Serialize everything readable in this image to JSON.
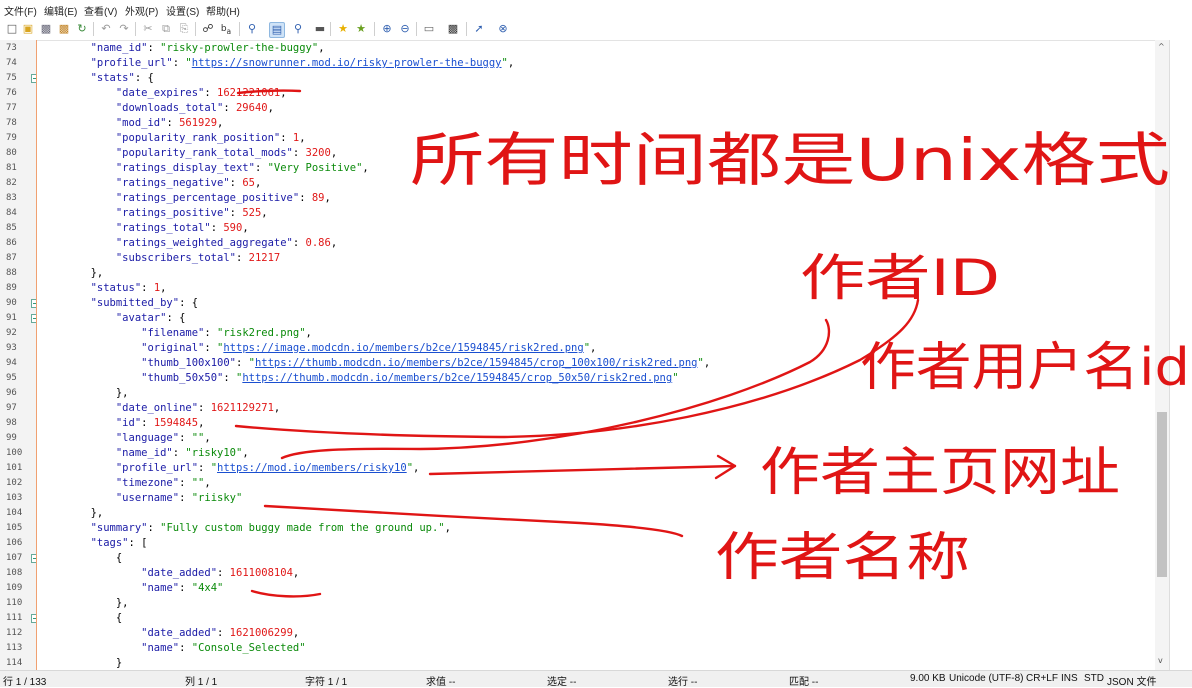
{
  "menu": [
    "文件(F)",
    "编辑(E)",
    "查看(V)",
    "外观(P)",
    "设置(S)",
    "帮助(H)"
  ],
  "toolbar_icons": [
    "new-file-icon",
    "open-file-icon",
    "save-icon",
    "save-all-icon",
    "reload-icon",
    "undo-icon",
    "redo-icon",
    "cut-icon",
    "copy-icon",
    "paste-icon",
    "find-icon",
    "replace-icon",
    "find-in-files-icon",
    "wrap-toggle-icon",
    "zoom-icon",
    "bookmark-icon",
    "bookmark-next-icon",
    "zoom-in-icon",
    "zoom-out-icon",
    "view-icon",
    "terminal-icon",
    "pin-icon",
    "close-icon"
  ],
  "code": {
    "line_numbers": [
      "73",
      "74",
      "75",
      "76",
      "77",
      "78",
      "79",
      "80",
      "81",
      "82",
      "83",
      "84",
      "85",
      "86",
      "87",
      "88",
      "89",
      "90",
      "91",
      "92",
      "93",
      "94",
      "95",
      "96",
      "97",
      "98",
      "99",
      "100",
      "101",
      "102",
      "103",
      "104",
      "105",
      "106",
      "107",
      "108",
      "109",
      "110",
      "111",
      "112",
      "113",
      "114"
    ],
    "folds": [
      "75",
      "90",
      "91",
      "107",
      "111"
    ],
    "lines": [
      {
        "indent": "        ",
        "parts": [
          {
            "c": "k",
            "t": "\"name_id\""
          },
          {
            "c": "p",
            "t": ": "
          },
          {
            "c": "s",
            "t": "\"risky-prowler-the-buggy\""
          },
          {
            "c": "p",
            "t": ","
          }
        ]
      },
      {
        "indent": "        ",
        "parts": [
          {
            "c": "k",
            "t": "\"profile_url\""
          },
          {
            "c": "p",
            "t": ": "
          },
          {
            "c": "q",
            "t": "\""
          },
          {
            "c": "u",
            "t": "https://snowrunner.mod.io/risky-prowler-the-buggy"
          },
          {
            "c": "q",
            "t": "\""
          },
          {
            "c": "p",
            "t": ","
          }
        ]
      },
      {
        "indent": "        ",
        "parts": [
          {
            "c": "k",
            "t": "\"stats\""
          },
          {
            "c": "p",
            "t": ": {"
          }
        ]
      },
      {
        "indent": "            ",
        "parts": [
          {
            "c": "k",
            "t": "\"date_expires\""
          },
          {
            "c": "p",
            "t": ": "
          },
          {
            "c": "n",
            "t": "1621221061"
          },
          {
            "c": "p",
            "t": ","
          }
        ]
      },
      {
        "indent": "            ",
        "parts": [
          {
            "c": "k",
            "t": "\"downloads_total\""
          },
          {
            "c": "p",
            "t": ": "
          },
          {
            "c": "n",
            "t": "29640"
          },
          {
            "c": "p",
            "t": ","
          }
        ]
      },
      {
        "indent": "            ",
        "parts": [
          {
            "c": "k",
            "t": "\"mod_id\""
          },
          {
            "c": "p",
            "t": ": "
          },
          {
            "c": "n",
            "t": "561929"
          },
          {
            "c": "p",
            "t": ","
          }
        ]
      },
      {
        "indent": "            ",
        "parts": [
          {
            "c": "k",
            "t": "\"popularity_rank_position\""
          },
          {
            "c": "p",
            "t": ": "
          },
          {
            "c": "n",
            "t": "1"
          },
          {
            "c": "p",
            "t": ","
          }
        ]
      },
      {
        "indent": "            ",
        "parts": [
          {
            "c": "k",
            "t": "\"popularity_rank_total_mods\""
          },
          {
            "c": "p",
            "t": ": "
          },
          {
            "c": "n",
            "t": "3200"
          },
          {
            "c": "p",
            "t": ","
          }
        ]
      },
      {
        "indent": "            ",
        "parts": [
          {
            "c": "k",
            "t": "\"ratings_display_text\""
          },
          {
            "c": "p",
            "t": ": "
          },
          {
            "c": "s",
            "t": "\"Very Positive\""
          },
          {
            "c": "p",
            "t": ","
          }
        ]
      },
      {
        "indent": "            ",
        "parts": [
          {
            "c": "k",
            "t": "\"ratings_negative\""
          },
          {
            "c": "p",
            "t": ": "
          },
          {
            "c": "n",
            "t": "65"
          },
          {
            "c": "p",
            "t": ","
          }
        ]
      },
      {
        "indent": "            ",
        "parts": [
          {
            "c": "k",
            "t": "\"ratings_percentage_positive\""
          },
          {
            "c": "p",
            "t": ": "
          },
          {
            "c": "n",
            "t": "89"
          },
          {
            "c": "p",
            "t": ","
          }
        ]
      },
      {
        "indent": "            ",
        "parts": [
          {
            "c": "k",
            "t": "\"ratings_positive\""
          },
          {
            "c": "p",
            "t": ": "
          },
          {
            "c": "n",
            "t": "525"
          },
          {
            "c": "p",
            "t": ","
          }
        ]
      },
      {
        "indent": "            ",
        "parts": [
          {
            "c": "k",
            "t": "\"ratings_total\""
          },
          {
            "c": "p",
            "t": ": "
          },
          {
            "c": "n",
            "t": "590"
          },
          {
            "c": "p",
            "t": ","
          }
        ]
      },
      {
        "indent": "            ",
        "parts": [
          {
            "c": "k",
            "t": "\"ratings_weighted_aggregate\""
          },
          {
            "c": "p",
            "t": ": "
          },
          {
            "c": "n",
            "t": "0.86"
          },
          {
            "c": "p",
            "t": ","
          }
        ]
      },
      {
        "indent": "            ",
        "parts": [
          {
            "c": "k",
            "t": "\"subscribers_total\""
          },
          {
            "c": "p",
            "t": ": "
          },
          {
            "c": "n",
            "t": "21217"
          }
        ]
      },
      {
        "indent": "        ",
        "parts": [
          {
            "c": "p",
            "t": "},"
          }
        ]
      },
      {
        "indent": "        ",
        "parts": [
          {
            "c": "k",
            "t": "\"status\""
          },
          {
            "c": "p",
            "t": ": "
          },
          {
            "c": "n",
            "t": "1"
          },
          {
            "c": "p",
            "t": ","
          }
        ]
      },
      {
        "indent": "        ",
        "parts": [
          {
            "c": "k",
            "t": "\"submitted_by\""
          },
          {
            "c": "p",
            "t": ": {"
          }
        ]
      },
      {
        "indent": "            ",
        "parts": [
          {
            "c": "k",
            "t": "\"avatar\""
          },
          {
            "c": "p",
            "t": ": {"
          }
        ]
      },
      {
        "indent": "                ",
        "parts": [
          {
            "c": "k",
            "t": "\"filename\""
          },
          {
            "c": "p",
            "t": ": "
          },
          {
            "c": "s",
            "t": "\"risk2red.png\""
          },
          {
            "c": "p",
            "t": ","
          }
        ]
      },
      {
        "indent": "                ",
        "parts": [
          {
            "c": "k",
            "t": "\"original\""
          },
          {
            "c": "p",
            "t": ": "
          },
          {
            "c": "q",
            "t": "\""
          },
          {
            "c": "u",
            "t": "https://image.modcdn.io/members/b2ce/1594845/risk2red.png"
          },
          {
            "c": "q",
            "t": "\""
          },
          {
            "c": "p",
            "t": ","
          }
        ]
      },
      {
        "indent": "                ",
        "parts": [
          {
            "c": "k",
            "t": "\"thumb_100x100\""
          },
          {
            "c": "p",
            "t": ": "
          },
          {
            "c": "q",
            "t": "\""
          },
          {
            "c": "u",
            "t": "https://thumb.modcdn.io/members/b2ce/1594845/crop_100x100/risk2red.png"
          },
          {
            "c": "q",
            "t": "\""
          },
          {
            "c": "p",
            "t": ","
          }
        ]
      },
      {
        "indent": "                ",
        "parts": [
          {
            "c": "k",
            "t": "\"thumb_50x50\""
          },
          {
            "c": "p",
            "t": ": "
          },
          {
            "c": "q",
            "t": "\""
          },
          {
            "c": "u",
            "t": "https://thumb.modcdn.io/members/b2ce/1594845/crop_50x50/risk2red.png"
          },
          {
            "c": "q",
            "t": "\""
          }
        ]
      },
      {
        "indent": "            ",
        "parts": [
          {
            "c": "p",
            "t": "},"
          }
        ]
      },
      {
        "indent": "            ",
        "parts": [
          {
            "c": "k",
            "t": "\"date_online\""
          },
          {
            "c": "p",
            "t": ": "
          },
          {
            "c": "n",
            "t": "1621129271"
          },
          {
            "c": "p",
            "t": ","
          }
        ]
      },
      {
        "indent": "            ",
        "parts": [
          {
            "c": "k",
            "t": "\"id\""
          },
          {
            "c": "p",
            "t": ": "
          },
          {
            "c": "n",
            "t": "1594845"
          },
          {
            "c": "p",
            "t": ","
          }
        ]
      },
      {
        "indent": "            ",
        "parts": [
          {
            "c": "k",
            "t": "\"language\""
          },
          {
            "c": "p",
            "t": ": "
          },
          {
            "c": "s",
            "t": "\"\""
          },
          {
            "c": "p",
            "t": ","
          }
        ]
      },
      {
        "indent": "            ",
        "parts": [
          {
            "c": "k",
            "t": "\"name_id\""
          },
          {
            "c": "p",
            "t": ": "
          },
          {
            "c": "s",
            "t": "\"risky10\""
          },
          {
            "c": "p",
            "t": ","
          }
        ]
      },
      {
        "indent": "            ",
        "parts": [
          {
            "c": "k",
            "t": "\"profile_url\""
          },
          {
            "c": "p",
            "t": ": "
          },
          {
            "c": "q",
            "t": "\""
          },
          {
            "c": "u",
            "t": "https://mod.io/members/risky10"
          },
          {
            "c": "q",
            "t": "\""
          },
          {
            "c": "p",
            "t": ","
          }
        ]
      },
      {
        "indent": "            ",
        "parts": [
          {
            "c": "k",
            "t": "\"timezone\""
          },
          {
            "c": "p",
            "t": ": "
          },
          {
            "c": "s",
            "t": "\"\""
          },
          {
            "c": "p",
            "t": ","
          }
        ]
      },
      {
        "indent": "            ",
        "parts": [
          {
            "c": "k",
            "t": "\"username\""
          },
          {
            "c": "p",
            "t": ": "
          },
          {
            "c": "s",
            "t": "\"riisky\""
          }
        ]
      },
      {
        "indent": "        ",
        "parts": [
          {
            "c": "p",
            "t": "},"
          }
        ]
      },
      {
        "indent": "        ",
        "parts": [
          {
            "c": "k",
            "t": "\"summary\""
          },
          {
            "c": "p",
            "t": ": "
          },
          {
            "c": "s",
            "t": "\"Fully custom buggy made from the ground up.\""
          },
          {
            "c": "p",
            "t": ","
          }
        ]
      },
      {
        "indent": "        ",
        "parts": [
          {
            "c": "k",
            "t": "\"tags\""
          },
          {
            "c": "p",
            "t": ": ["
          }
        ]
      },
      {
        "indent": "            ",
        "parts": [
          {
            "c": "p",
            "t": "{"
          }
        ]
      },
      {
        "indent": "                ",
        "parts": [
          {
            "c": "k",
            "t": "\"date_added\""
          },
          {
            "c": "p",
            "t": ": "
          },
          {
            "c": "n",
            "t": "1611008104"
          },
          {
            "c": "p",
            "t": ","
          }
        ]
      },
      {
        "indent": "                ",
        "parts": [
          {
            "c": "k",
            "t": "\"name\""
          },
          {
            "c": "p",
            "t": ": "
          },
          {
            "c": "s",
            "t": "\"4x4\""
          }
        ]
      },
      {
        "indent": "            ",
        "parts": [
          {
            "c": "p",
            "t": "},"
          }
        ]
      },
      {
        "indent": "            ",
        "parts": [
          {
            "c": "p",
            "t": "{"
          }
        ]
      },
      {
        "indent": "                ",
        "parts": [
          {
            "c": "k",
            "t": "\"date_added\""
          },
          {
            "c": "p",
            "t": ": "
          },
          {
            "c": "n",
            "t": "1621006299"
          },
          {
            "c": "p",
            "t": ","
          }
        ]
      },
      {
        "indent": "                ",
        "parts": [
          {
            "c": "k",
            "t": "\"name\""
          },
          {
            "c": "p",
            "t": ": "
          },
          {
            "c": "s",
            "t": "\"Console_Selected\""
          }
        ]
      },
      {
        "indent": "            ",
        "parts": [
          {
            "c": "p",
            "t": "}"
          }
        ]
      }
    ]
  },
  "scroll_up": "^",
  "scroll_down": "v",
  "annotations": {
    "note_unix": "所有时间都是Unix格式",
    "note_author_id": "作者ID",
    "note_author_user_id": "作者用户名id",
    "note_author_homepage": "作者主页网址",
    "note_author_name": "作者名称",
    "ink_color": "#e01515"
  },
  "status": {
    "line": "行 1 / 133",
    "col": "列 1 / 1",
    "char": "字符 1 / 1",
    "value": "求值 --",
    "selection": "选定 --",
    "selected_lines": "选行 --",
    "match": "匹配 --",
    "size": "9.00 KB",
    "encoding": "Unicode (UTF-8)",
    "eol": "CR+LF",
    "ins": "INS",
    "std": "STD",
    "filetype": "JSON 文件"
  }
}
